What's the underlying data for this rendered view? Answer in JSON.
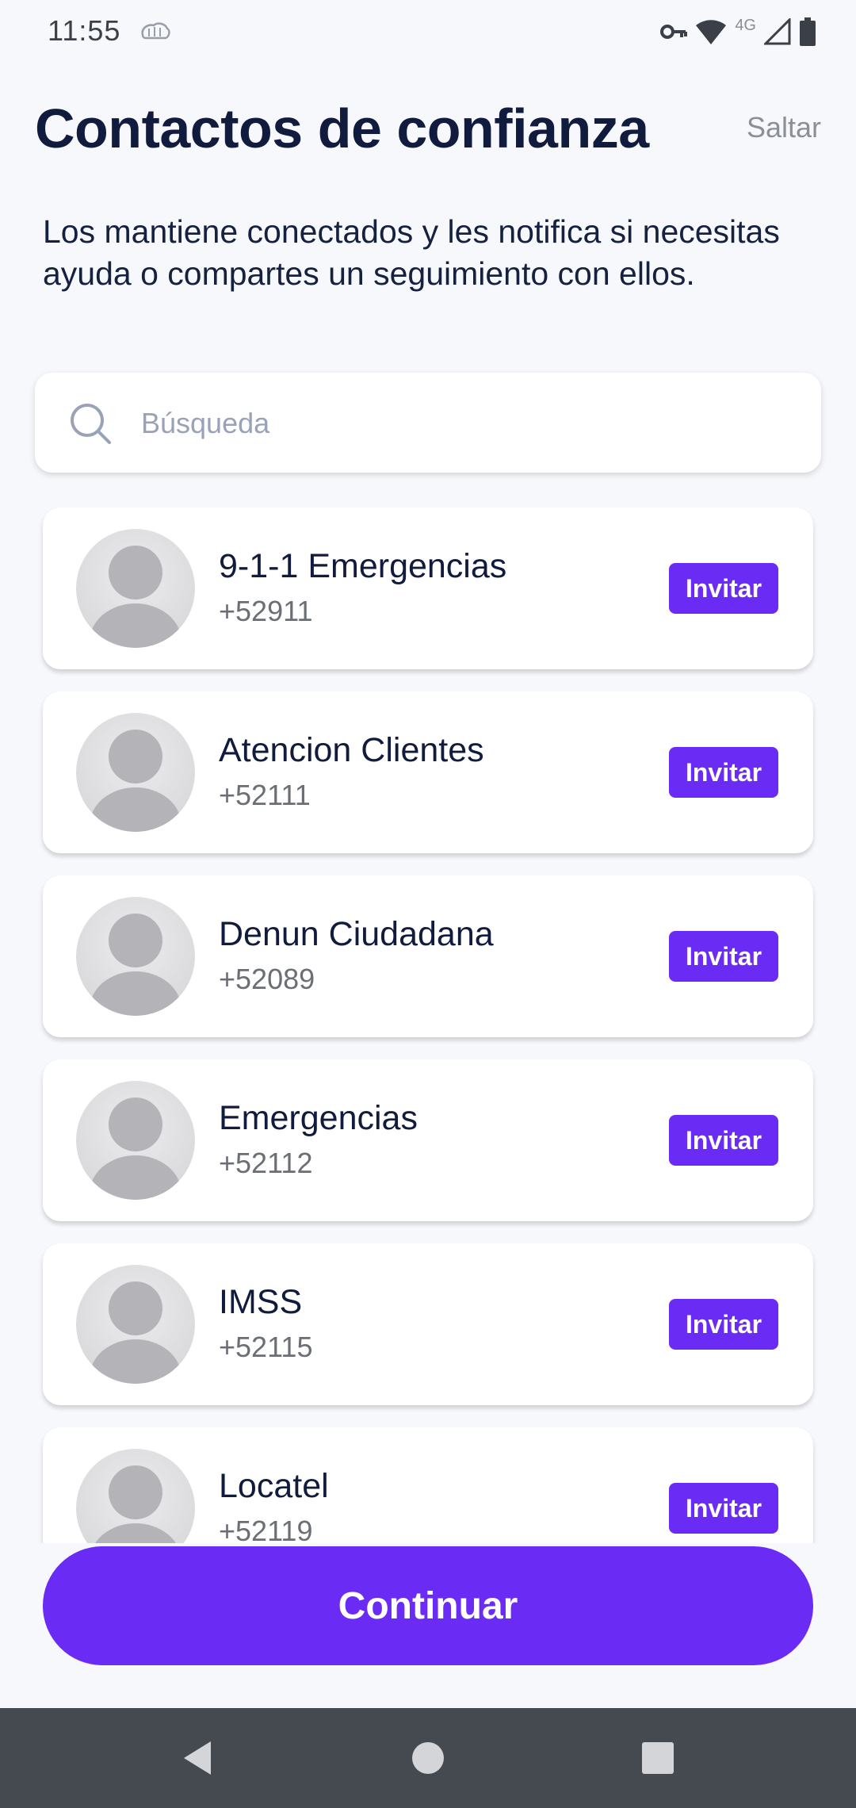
{
  "status_bar": {
    "time": "11:55",
    "network": "4G",
    "icons": [
      "brain-icon",
      "vpn-key-icon",
      "wifi-icon",
      "signal-icon",
      "battery-icon"
    ]
  },
  "header": {
    "title": "Contactos de confianza",
    "skip_label": "Saltar",
    "description": "Los mantiene conectados y les notifica si necesitas ayuda o compartes un seguimiento con ellos."
  },
  "search": {
    "placeholder": "Búsqueda",
    "value": "",
    "icon": "search-icon"
  },
  "contacts": [
    {
      "name": "9-1-1 Emergencias",
      "phone": "+52911",
      "action": "Invitar"
    },
    {
      "name": "Atencion Clientes",
      "phone": "+52111",
      "action": "Invitar"
    },
    {
      "name": "Denun Ciudadana",
      "phone": "+52089",
      "action": "Invitar"
    },
    {
      "name": "Emergencias",
      "phone": "+52112",
      "action": "Invitar"
    },
    {
      "name": "IMSS",
      "phone": "+52115",
      "action": "Invitar"
    },
    {
      "name": "Locatel",
      "phone": "+52119",
      "action": "Invitar"
    }
  ],
  "continue_label": "Continuar",
  "nav": {
    "icons": [
      "back-icon",
      "home-icon",
      "recents-icon"
    ]
  },
  "colors": {
    "accent": "#6a2cf5",
    "background": "#f6f8fb",
    "title_text": "#111b3d",
    "secondary_text": "#6b6e75",
    "nav_bar": "#444a50"
  }
}
